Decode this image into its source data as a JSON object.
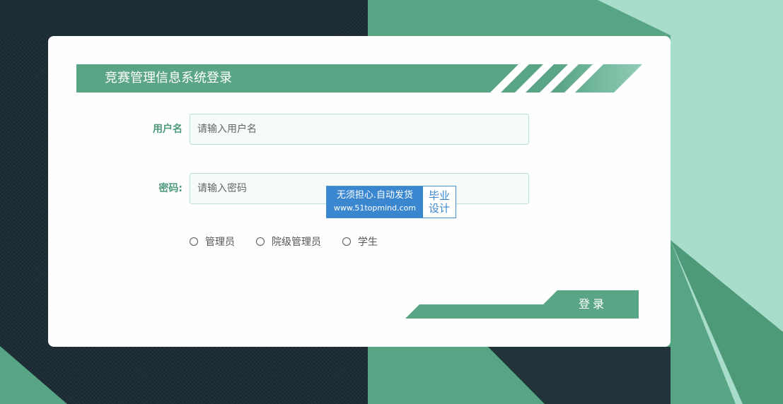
{
  "app": {
    "title": "竞赛管理信息系统登录"
  },
  "form": {
    "username": {
      "label": "用户名",
      "placeholder": "请输入用户名",
      "value": ""
    },
    "password": {
      "label": "密码:",
      "placeholder": "请输入密码",
      "value": ""
    },
    "roles": [
      {
        "label": "管理员",
        "selected": false
      },
      {
        "label": "院级管理员",
        "selected": false
      },
      {
        "label": "学生",
        "selected": false
      }
    ],
    "login_label": "登录"
  },
  "watermark": {
    "line1": "无须担心.自动发货",
    "url": "www.51topmind.com",
    "side_line1": "毕业",
    "side_line2": "设计"
  },
  "colors": {
    "accent": "#5aa586",
    "accent_light": "#a8dccb",
    "background_dark": "#1d2d36",
    "card": "#fdfefd"
  }
}
